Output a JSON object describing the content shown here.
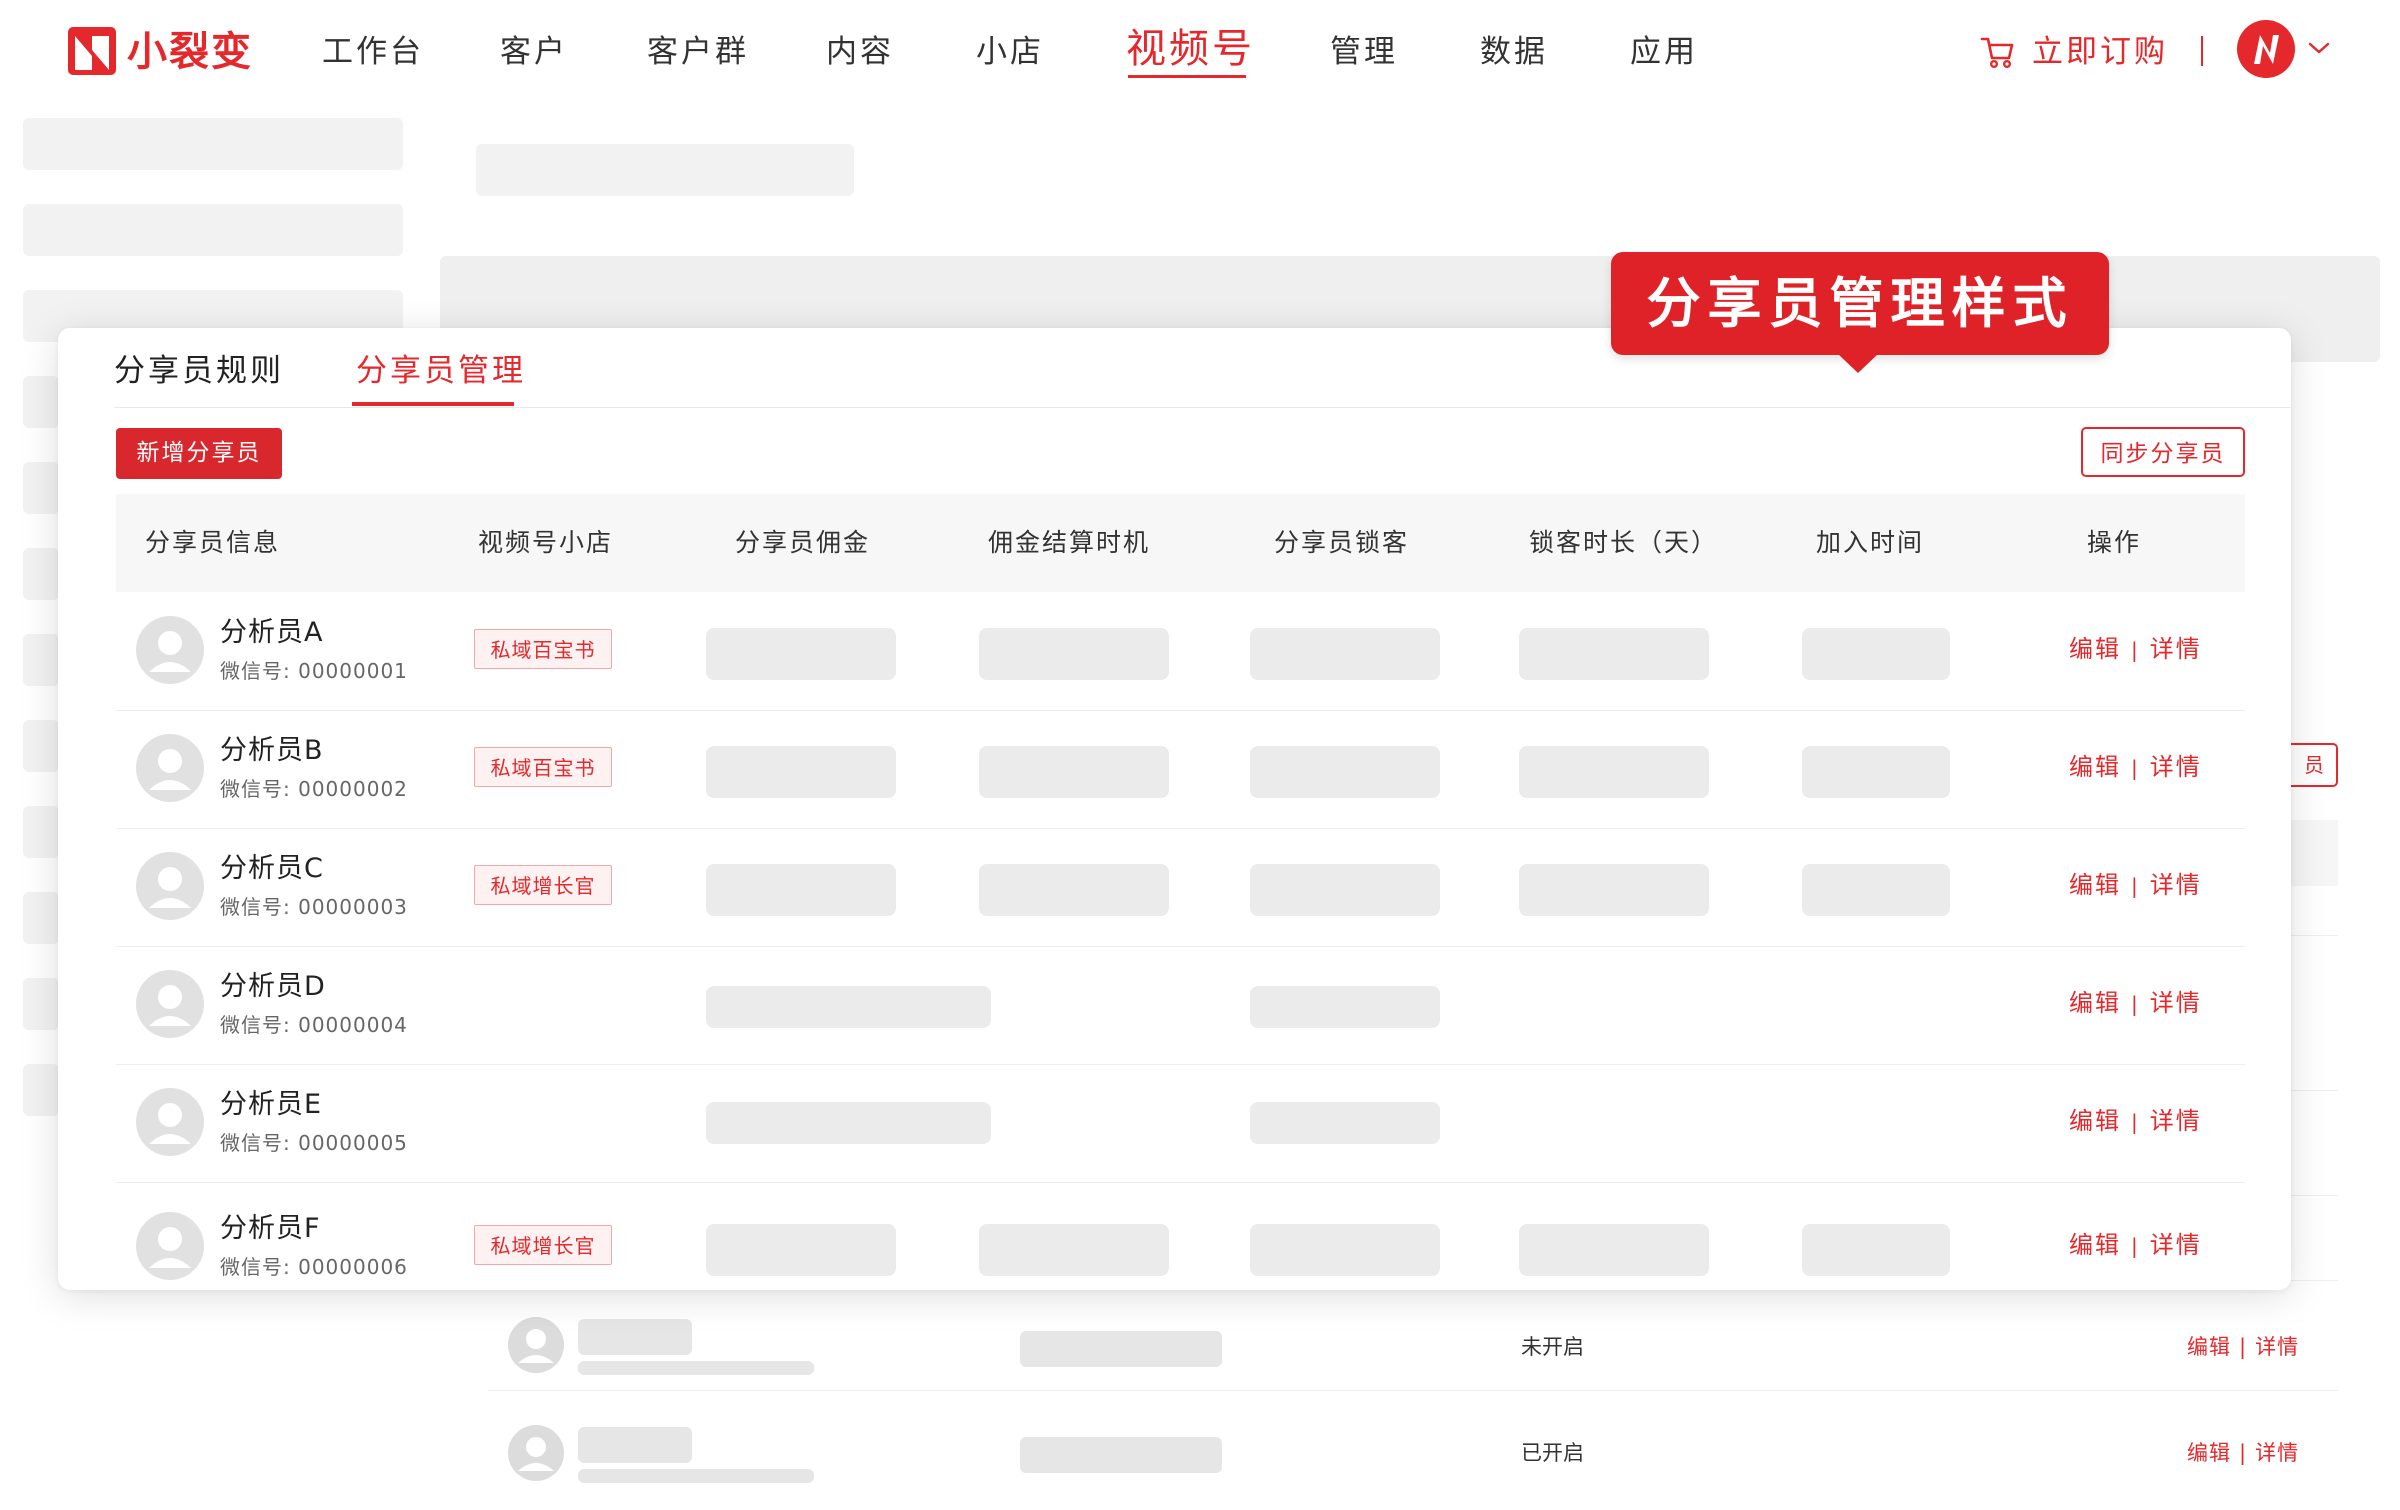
{
  "brand": {
    "name": "小裂变",
    "color": "#e5282b"
  },
  "nav": {
    "items": [
      {
        "label": "工作台"
      },
      {
        "label": "客户"
      },
      {
        "label": "客户群"
      },
      {
        "label": "内容"
      },
      {
        "label": "小店"
      },
      {
        "label": "视频号"
      },
      {
        "label": "管理"
      },
      {
        "label": "数据"
      },
      {
        "label": "应用"
      }
    ],
    "active": "视频号",
    "order_label": "立即订购"
  },
  "callout": {
    "text": "分享员管理样式"
  },
  "card": {
    "tabs": [
      {
        "label": "分享员规则"
      },
      {
        "label": "分享员管理"
      }
    ],
    "active_tab": "分享员管理",
    "add_button": "新增分享员",
    "sync_button": "同步分享员",
    "columns": [
      "分享员信息",
      "视频号小店",
      "分享员佣金",
      "佣金结算时机",
      "分享员锁客",
      "锁客时长（天）",
      "加入时间",
      "操作"
    ],
    "rows": [
      {
        "name": "分析员A",
        "wechat": "微信号: 00000001",
        "shop_tag": "私域百宝书"
      },
      {
        "name": "分析员B",
        "wechat": "微信号: 00000002",
        "shop_tag": "私域百宝书"
      },
      {
        "name": "分析员C",
        "wechat": "微信号: 00000003",
        "shop_tag": "私域增长官"
      },
      {
        "name": "分析员D",
        "wechat": "微信号: 00000004",
        "shop_tag": ""
      },
      {
        "name": "分析员E",
        "wechat": "微信号: 00000005",
        "shop_tag": ""
      },
      {
        "name": "分析员F",
        "wechat": "微信号: 00000006",
        "shop_tag": "私域增长官"
      }
    ],
    "action_edit": "编辑",
    "action_detail": "详情",
    "action_sep": "|"
  },
  "background": {
    "partial_button": "员",
    "rows": [
      {
        "status": "未开启",
        "edit": "编辑",
        "detail": "详情"
      },
      {
        "status": "已开启",
        "edit": "编辑",
        "detail": "详情"
      }
    ]
  }
}
